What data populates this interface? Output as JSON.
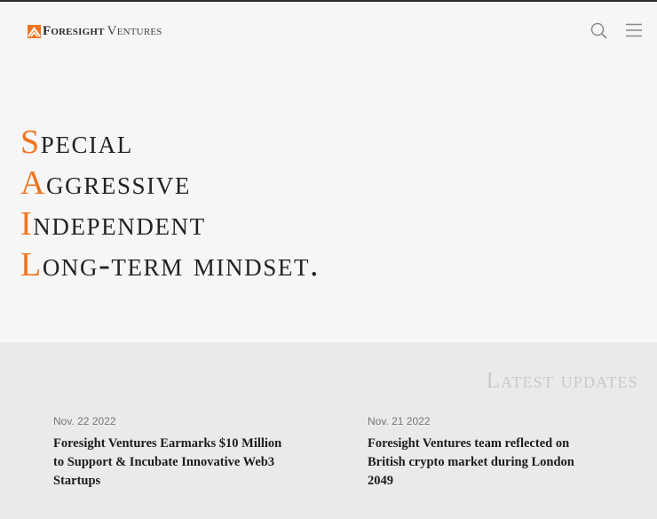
{
  "brand": {
    "name_bold": "Foresight",
    "name_light": "Ventures",
    "accent_color": "#f07420"
  },
  "header": {
    "search_icon": "search-icon",
    "menu_icon": "hamburger-menu-icon"
  },
  "hero": {
    "lines": [
      {
        "initial": "S",
        "rest": "pecial"
      },
      {
        "initial": "A",
        "rest": "ggressive"
      },
      {
        "initial": "I",
        "rest": "ndependent"
      },
      {
        "initial": "L",
        "rest": "ong-term mindset."
      }
    ]
  },
  "updates": {
    "title": "Latest updates",
    "items": [
      {
        "date": "Nov. 22 2022",
        "title": "Foresight Ventures Earmarks $10 Million to Support & Incubate Innovative Web3 Startups"
      },
      {
        "date": "Nov. 21 2022",
        "title": "Foresight Ventures team reflected on British crypto market during London 2049"
      }
    ]
  }
}
